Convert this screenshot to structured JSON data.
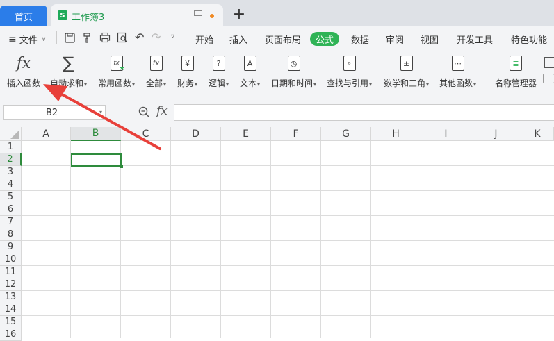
{
  "tabs": {
    "home": "首页",
    "document": "工作簿3",
    "document_logo": "S",
    "new_tab": "+",
    "unsaved_dot_color": "#f08a24"
  },
  "menu": {
    "file": "文件",
    "items": [
      "开始",
      "插入",
      "页面布局",
      "公式",
      "数据",
      "审阅",
      "视图",
      "开发工具",
      "特色功能"
    ],
    "active": "公式",
    "active_color": "#2fb356"
  },
  "ribbon": {
    "buttons": [
      {
        "label": "插入函数",
        "icon": "fx-icon",
        "glyph": "fx"
      },
      {
        "label": "自动求和",
        "icon": "sigma-icon",
        "glyph": "∑"
      },
      {
        "label": "常用函数",
        "icon": "common-functions-icon",
        "glyph": "fx"
      },
      {
        "label": "全部",
        "icon": "all-functions-icon",
        "glyph": "fx"
      },
      {
        "label": "财务",
        "icon": "finance-icon",
        "glyph": "¥"
      },
      {
        "label": "逻辑",
        "icon": "logic-icon",
        "glyph": "?"
      },
      {
        "label": "文本",
        "icon": "text-icon",
        "glyph": "A"
      },
      {
        "label": "日期和时间",
        "icon": "clock-icon",
        "glyph": "◷"
      },
      {
        "label": "查找与引用",
        "icon": "lookup-icon",
        "glyph": "⌕"
      },
      {
        "label": "数学和三角",
        "icon": "math-icon",
        "glyph": "±"
      },
      {
        "label": "其他函数",
        "icon": "other-functions-icon",
        "glyph": "⋯"
      },
      {
        "label": "名称管理器",
        "icon": "name-manager-icon",
        "glyph": "≣"
      }
    ]
  },
  "formula_bar": {
    "name_box": "B2",
    "fx": "fx",
    "value": ""
  },
  "grid": {
    "columns": [
      "A",
      "B",
      "C",
      "D",
      "E",
      "F",
      "G",
      "H",
      "I",
      "J",
      "K"
    ],
    "rows": [
      "1",
      "2",
      "3",
      "4",
      "5",
      "6",
      "7",
      "8",
      "9",
      "10",
      "11",
      "12",
      "13",
      "14",
      "15",
      "16"
    ],
    "selected_cell": "B2",
    "selection_color": "#2e8b3c"
  },
  "annotation": {
    "arrow_color": "#e8403a"
  }
}
